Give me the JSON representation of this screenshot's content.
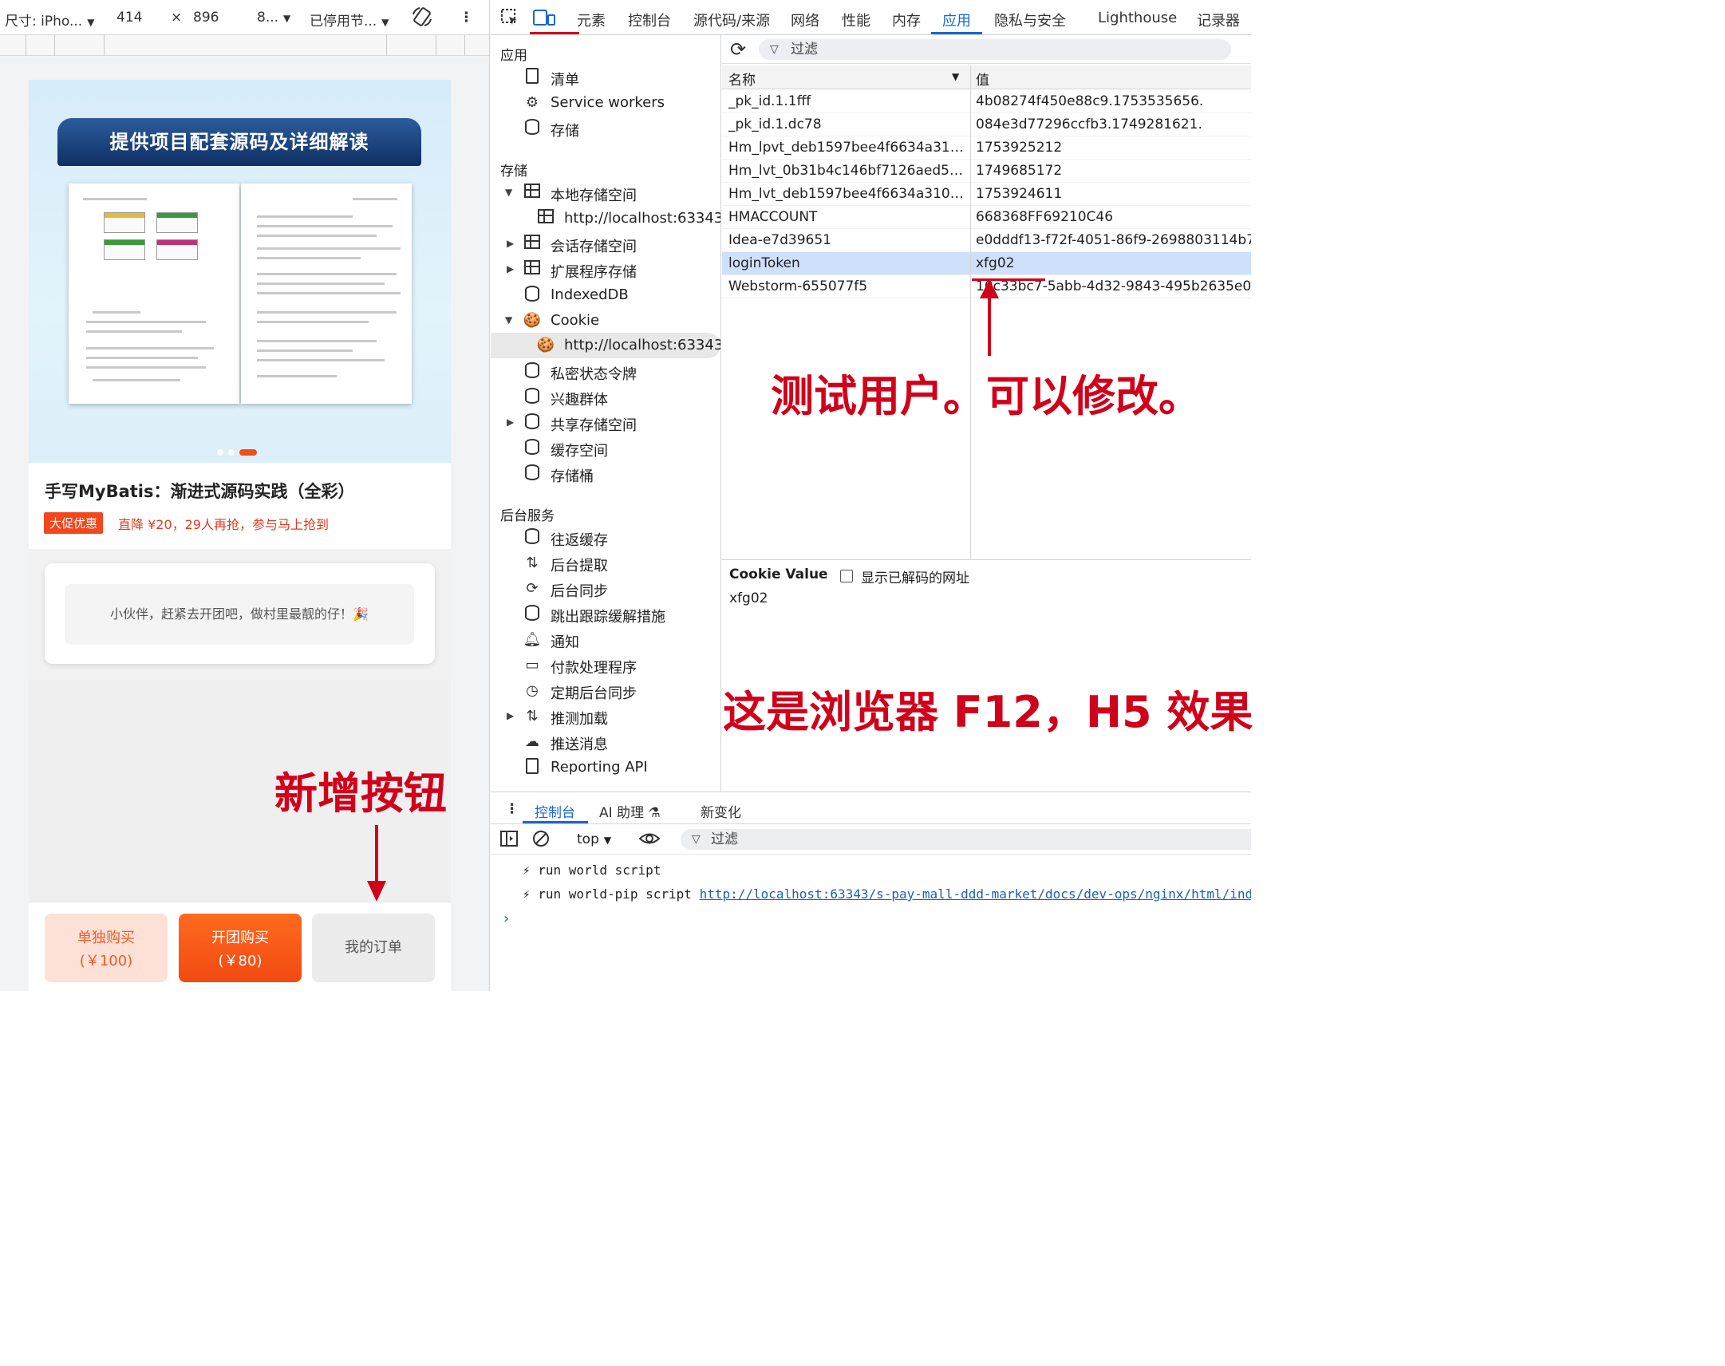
{
  "device_toolbar": {
    "device": "尺寸: iPho...",
    "width": "414",
    "times": "×",
    "height": "896",
    "zoom": "8...",
    "throttle": "已停用节...",
    "more": "⋮"
  },
  "phone": {
    "hero_banner": "提供项目配套源码及详细解读",
    "product_title": "手写MyBatis：渐进式源码实践（全彩）",
    "promo_badge": "大促优惠",
    "promo_text": "直降 ¥20，29人再抢，参与马上抢到",
    "card_message": "小伙伴，赶紧去开团吧，做村里最靓的仔！🎉",
    "buttons": {
      "single_label": "单独购买",
      "single_price": "(￥100)",
      "group_label": "开团购买",
      "group_price": "(￥80)",
      "orders_label": "我的订单"
    }
  },
  "devtools": {
    "tabs": [
      "元素",
      "控制台",
      "源代码/来源",
      "网络",
      "性能",
      "内存",
      "应用",
      "隐私与安全",
      "Lighthouse",
      "记录器"
    ],
    "active_tab": "应用",
    "sidebar": {
      "section_app": "应用",
      "app_items": [
        "清单",
        "Service workers",
        "存储"
      ],
      "section_storage": "存储",
      "local_storage": "本地存储空间",
      "local_storage_origin": "http://localhost:63343",
      "session_storage": "会话存储空间",
      "extension_storage": "扩展程序存储",
      "indexeddb": "IndexedDB",
      "cookie": "Cookie",
      "cookie_origin": "http://localhost:63343",
      "storage_rest": [
        "私密状态令牌",
        "兴趣群体",
        "共享存储空间",
        "缓存空间",
        "存储桶"
      ],
      "section_background": "后台服务",
      "background_items": [
        "往返缓存",
        "后台提取",
        "后台同步",
        "跳出跟踪缓解措施",
        "通知",
        "付款处理程序",
        "定期后台同步",
        "推测加载",
        "推送消息",
        "Reporting API"
      ]
    },
    "filter_placeholder": "过滤",
    "table": {
      "col_name": "名称",
      "col_value": "值",
      "rows": [
        {
          "name": "_pk_id.1.1fff",
          "value": "4b08274f450e88c9.1753535656."
        },
        {
          "name": "_pk_id.1.dc78",
          "value": "084e3d77296ccfb3.1749281621."
        },
        {
          "name": "Hm_lpvt_deb1597bee4f6634a310...",
          "value": "1753925212"
        },
        {
          "name": "Hm_lvt_0b31b4c146bf7126aed50...",
          "value": "1749685172"
        },
        {
          "name": "Hm_lvt_deb1597bee4f6634a3102...",
          "value": "1753924611"
        },
        {
          "name": "HMACCOUNT",
          "value": "668368FF69210C46"
        },
        {
          "name": "Idea-e7d39651",
          "value": "e0dddf13-f72f-4051-86f9-2698803114b7"
        },
        {
          "name": "loginToken",
          "value": "xfg02"
        },
        {
          "name": "Webstorm-655077f5",
          "value": "10c33bc7-5abb-4d32-9843-495b2635e0"
        }
      ],
      "selected_index": 7
    },
    "cookie_value": {
      "title": "Cookie Value",
      "checkbox_label": "显示已解码的网址",
      "value": "xfg02"
    },
    "drawer": {
      "tabs": [
        "控制台",
        "AI 助理 ⚗",
        "新变化"
      ],
      "context": "top",
      "filter_placeholder": "过滤",
      "lines": [
        {
          "prefix": "⚡ run world script",
          "link": ""
        },
        {
          "prefix": "⚡ run world-pip script ",
          "link": "http://localhost:63343/s-pay-mall-ddd-market/docs/dev-ops/nginx/html/ind"
        }
      ],
      "prompt": "›"
    }
  },
  "annotations": {
    "test_user": "测试用户。可以修改。",
    "f12": "这是浏览器 F12，H5 效果",
    "new_button": "新增按钮"
  },
  "colors": {
    "accent_blue": "#1a66d2",
    "annotation_red": "#d0021b",
    "orange": "#f24a12"
  }
}
